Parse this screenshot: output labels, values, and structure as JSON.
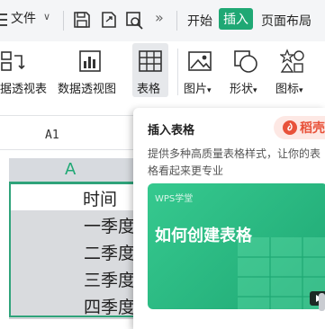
{
  "topbar": {
    "file_label": "文件",
    "tabs": [
      "开始",
      "插入",
      "页面布局"
    ]
  },
  "ribbon": {
    "items": [
      {
        "label": "据透视表"
      },
      {
        "label": "数据透视图"
      },
      {
        "label": "表格"
      },
      {
        "label": "图片"
      },
      {
        "label": "形状"
      },
      {
        "label": "图标"
      }
    ]
  },
  "sheet": {
    "name_box": "A1",
    "column_header": "A",
    "cells": [
      "时间",
      "一季度",
      "二季度",
      "三季度",
      "四季度"
    ]
  },
  "tooltip": {
    "title": "插入表格",
    "badge": "稻壳",
    "description_line1": "提供多种高质量表格样式，让你的表",
    "description_line2": "格看起来更专业",
    "video_brand": "WPS学堂",
    "video_title": "如何创建表格"
  },
  "colors": {
    "accent": "#1fa874",
    "badge_red": "#e8523a"
  }
}
